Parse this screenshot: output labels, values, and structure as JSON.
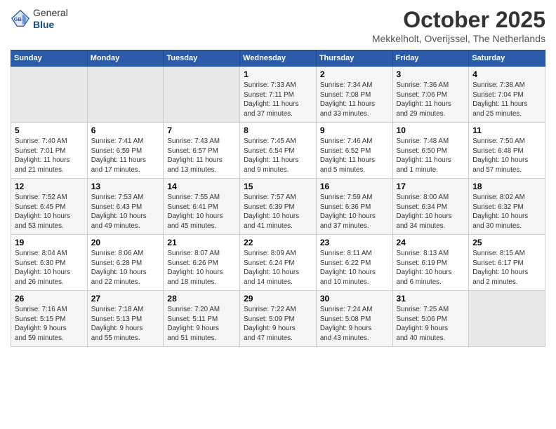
{
  "header": {
    "logo_general": "General",
    "logo_blue": "Blue",
    "month": "October 2025",
    "location": "Mekkelholt, Overijssel, The Netherlands"
  },
  "days_of_week": [
    "Sunday",
    "Monday",
    "Tuesday",
    "Wednesday",
    "Thursday",
    "Friday",
    "Saturday"
  ],
  "weeks": [
    [
      {
        "day": "",
        "info": ""
      },
      {
        "day": "",
        "info": ""
      },
      {
        "day": "",
        "info": ""
      },
      {
        "day": "1",
        "info": "Sunrise: 7:33 AM\nSunset: 7:11 PM\nDaylight: 11 hours\nand 37 minutes."
      },
      {
        "day": "2",
        "info": "Sunrise: 7:34 AM\nSunset: 7:08 PM\nDaylight: 11 hours\nand 33 minutes."
      },
      {
        "day": "3",
        "info": "Sunrise: 7:36 AM\nSunset: 7:06 PM\nDaylight: 11 hours\nand 29 minutes."
      },
      {
        "day": "4",
        "info": "Sunrise: 7:38 AM\nSunset: 7:04 PM\nDaylight: 11 hours\nand 25 minutes."
      }
    ],
    [
      {
        "day": "5",
        "info": "Sunrise: 7:40 AM\nSunset: 7:01 PM\nDaylight: 11 hours\nand 21 minutes."
      },
      {
        "day": "6",
        "info": "Sunrise: 7:41 AM\nSunset: 6:59 PM\nDaylight: 11 hours\nand 17 minutes."
      },
      {
        "day": "7",
        "info": "Sunrise: 7:43 AM\nSunset: 6:57 PM\nDaylight: 11 hours\nand 13 minutes."
      },
      {
        "day": "8",
        "info": "Sunrise: 7:45 AM\nSunset: 6:54 PM\nDaylight: 11 hours\nand 9 minutes."
      },
      {
        "day": "9",
        "info": "Sunrise: 7:46 AM\nSunset: 6:52 PM\nDaylight: 11 hours\nand 5 minutes."
      },
      {
        "day": "10",
        "info": "Sunrise: 7:48 AM\nSunset: 6:50 PM\nDaylight: 11 hours\nand 1 minute."
      },
      {
        "day": "11",
        "info": "Sunrise: 7:50 AM\nSunset: 6:48 PM\nDaylight: 10 hours\nand 57 minutes."
      }
    ],
    [
      {
        "day": "12",
        "info": "Sunrise: 7:52 AM\nSunset: 6:45 PM\nDaylight: 10 hours\nand 53 minutes."
      },
      {
        "day": "13",
        "info": "Sunrise: 7:53 AM\nSunset: 6:43 PM\nDaylight: 10 hours\nand 49 minutes."
      },
      {
        "day": "14",
        "info": "Sunrise: 7:55 AM\nSunset: 6:41 PM\nDaylight: 10 hours\nand 45 minutes."
      },
      {
        "day": "15",
        "info": "Sunrise: 7:57 AM\nSunset: 6:39 PM\nDaylight: 10 hours\nand 41 minutes."
      },
      {
        "day": "16",
        "info": "Sunrise: 7:59 AM\nSunset: 6:36 PM\nDaylight: 10 hours\nand 37 minutes."
      },
      {
        "day": "17",
        "info": "Sunrise: 8:00 AM\nSunset: 6:34 PM\nDaylight: 10 hours\nand 34 minutes."
      },
      {
        "day": "18",
        "info": "Sunrise: 8:02 AM\nSunset: 6:32 PM\nDaylight: 10 hours\nand 30 minutes."
      }
    ],
    [
      {
        "day": "19",
        "info": "Sunrise: 8:04 AM\nSunset: 6:30 PM\nDaylight: 10 hours\nand 26 minutes."
      },
      {
        "day": "20",
        "info": "Sunrise: 8:06 AM\nSunset: 6:28 PM\nDaylight: 10 hours\nand 22 minutes."
      },
      {
        "day": "21",
        "info": "Sunrise: 8:07 AM\nSunset: 6:26 PM\nDaylight: 10 hours\nand 18 minutes."
      },
      {
        "day": "22",
        "info": "Sunrise: 8:09 AM\nSunset: 6:24 PM\nDaylight: 10 hours\nand 14 minutes."
      },
      {
        "day": "23",
        "info": "Sunrise: 8:11 AM\nSunset: 6:22 PM\nDaylight: 10 hours\nand 10 minutes."
      },
      {
        "day": "24",
        "info": "Sunrise: 8:13 AM\nSunset: 6:19 PM\nDaylight: 10 hours\nand 6 minutes."
      },
      {
        "day": "25",
        "info": "Sunrise: 8:15 AM\nSunset: 6:17 PM\nDaylight: 10 hours\nand 2 minutes."
      }
    ],
    [
      {
        "day": "26",
        "info": "Sunrise: 7:16 AM\nSunset: 5:15 PM\nDaylight: 9 hours\nand 59 minutes."
      },
      {
        "day": "27",
        "info": "Sunrise: 7:18 AM\nSunset: 5:13 PM\nDaylight: 9 hours\nand 55 minutes."
      },
      {
        "day": "28",
        "info": "Sunrise: 7:20 AM\nSunset: 5:11 PM\nDaylight: 9 hours\nand 51 minutes."
      },
      {
        "day": "29",
        "info": "Sunrise: 7:22 AM\nSunset: 5:09 PM\nDaylight: 9 hours\nand 47 minutes."
      },
      {
        "day": "30",
        "info": "Sunrise: 7:24 AM\nSunset: 5:08 PM\nDaylight: 9 hours\nand 43 minutes."
      },
      {
        "day": "31",
        "info": "Sunrise: 7:25 AM\nSunset: 5:06 PM\nDaylight: 9 hours\nand 40 minutes."
      },
      {
        "day": "",
        "info": ""
      }
    ]
  ]
}
